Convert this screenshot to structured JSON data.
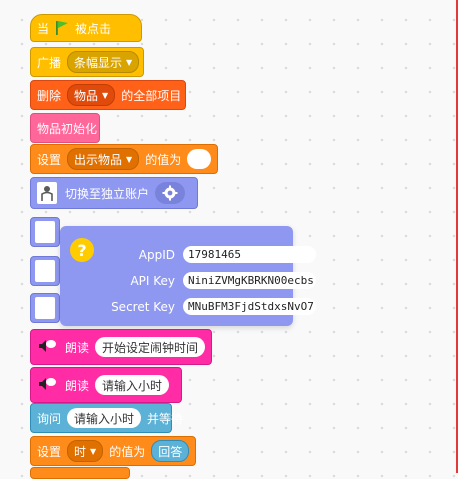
{
  "hat": {
    "prefix": "当",
    "suffix": "被点击",
    "flag_icon": "green-flag-icon"
  },
  "broadcast": {
    "label": "广播",
    "message": "条幅显示"
  },
  "delete_all": {
    "prefix": "删除",
    "list": "物品",
    "suffix": "的全部项目"
  },
  "init_items": {
    "label": "物品初始化"
  },
  "set_var1": {
    "prefix": "设置",
    "variable": "出示物品",
    "suffix": "的值为",
    "value": ""
  },
  "switch_account": {
    "label": "切换至独立账户",
    "gear_icon": "gear-icon"
  },
  "popup": {
    "fields": [
      {
        "label": "AppID",
        "value": "17981465"
      },
      {
        "label": "API Key",
        "value": "NiniZVMgKBRKN00ecbs"
      },
      {
        "label": "Secret Key",
        "value": "MNuBFM3FjdStdxsNvO7"
      }
    ]
  },
  "speak1": {
    "label": "朗读",
    "text": "开始设定闹钟时间"
  },
  "speak2": {
    "label": "朗读",
    "text": "请输入小时"
  },
  "ask": {
    "prefix": "询问",
    "question": "请输入小时",
    "suffix": "并等待"
  },
  "set_var2": {
    "prefix": "设置",
    "variable": "时",
    "suffix": "的值为",
    "value": "回答"
  },
  "colors": {
    "events": "#ffbf00",
    "variables": "#ff8c1a",
    "lists": "#ff6119",
    "custom": "#ff6699",
    "text_to_speech": "#ff2ca5",
    "sensing": "#5cb1d6",
    "extension": "#8f98f0"
  }
}
